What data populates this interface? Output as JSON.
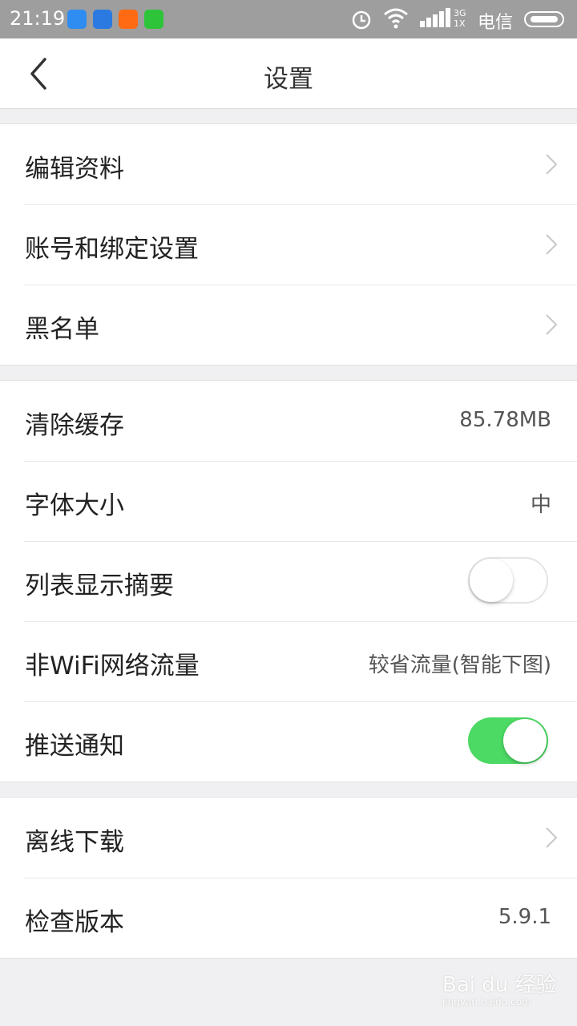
{
  "status_bar": {
    "time": "21:19",
    "network": "3G\n1X",
    "carrier": "电信",
    "icons": [
      "alarm-icon",
      "wifi-icon",
      "signal-icon",
      "battery-icon"
    ],
    "app_icons": [
      {
        "name": "app1-icon",
        "color": "#2f8cf0"
      },
      {
        "name": "app2-icon",
        "color": "#2a7ae2"
      },
      {
        "name": "app3-icon",
        "color": "#ff6a13"
      },
      {
        "name": "app4-icon",
        "color": "#2ec43a"
      }
    ]
  },
  "header": {
    "title": "设置",
    "back_icon": "chevron-left-icon"
  },
  "groups": [
    {
      "items": [
        {
          "label": "编辑资料",
          "accessory": "chevron"
        },
        {
          "label": "账号和绑定设置",
          "accessory": "chevron"
        },
        {
          "label": "黑名单",
          "accessory": "chevron"
        }
      ]
    },
    {
      "items": [
        {
          "label": "清除缓存",
          "value": "85.78MB"
        },
        {
          "label": "字体大小",
          "value": "中"
        },
        {
          "label": "列表显示摘要",
          "toggle": false
        },
        {
          "label": "非WiFi网络流量",
          "value": "较省流量(智能下图)"
        },
        {
          "label": "推送通知",
          "toggle": true
        }
      ]
    },
    {
      "items": [
        {
          "label": "离线下载",
          "accessory": "chevron"
        },
        {
          "label": "检查版本",
          "value": "5.9.1"
        }
      ]
    }
  ],
  "watermark": {
    "brand": "Bai du 经验",
    "url": "jingyan.baidu.com"
  },
  "colors": {
    "toggle_on": "#4cd964",
    "background": "#f0f0f2",
    "status_bar": "#9e9e9e"
  }
}
